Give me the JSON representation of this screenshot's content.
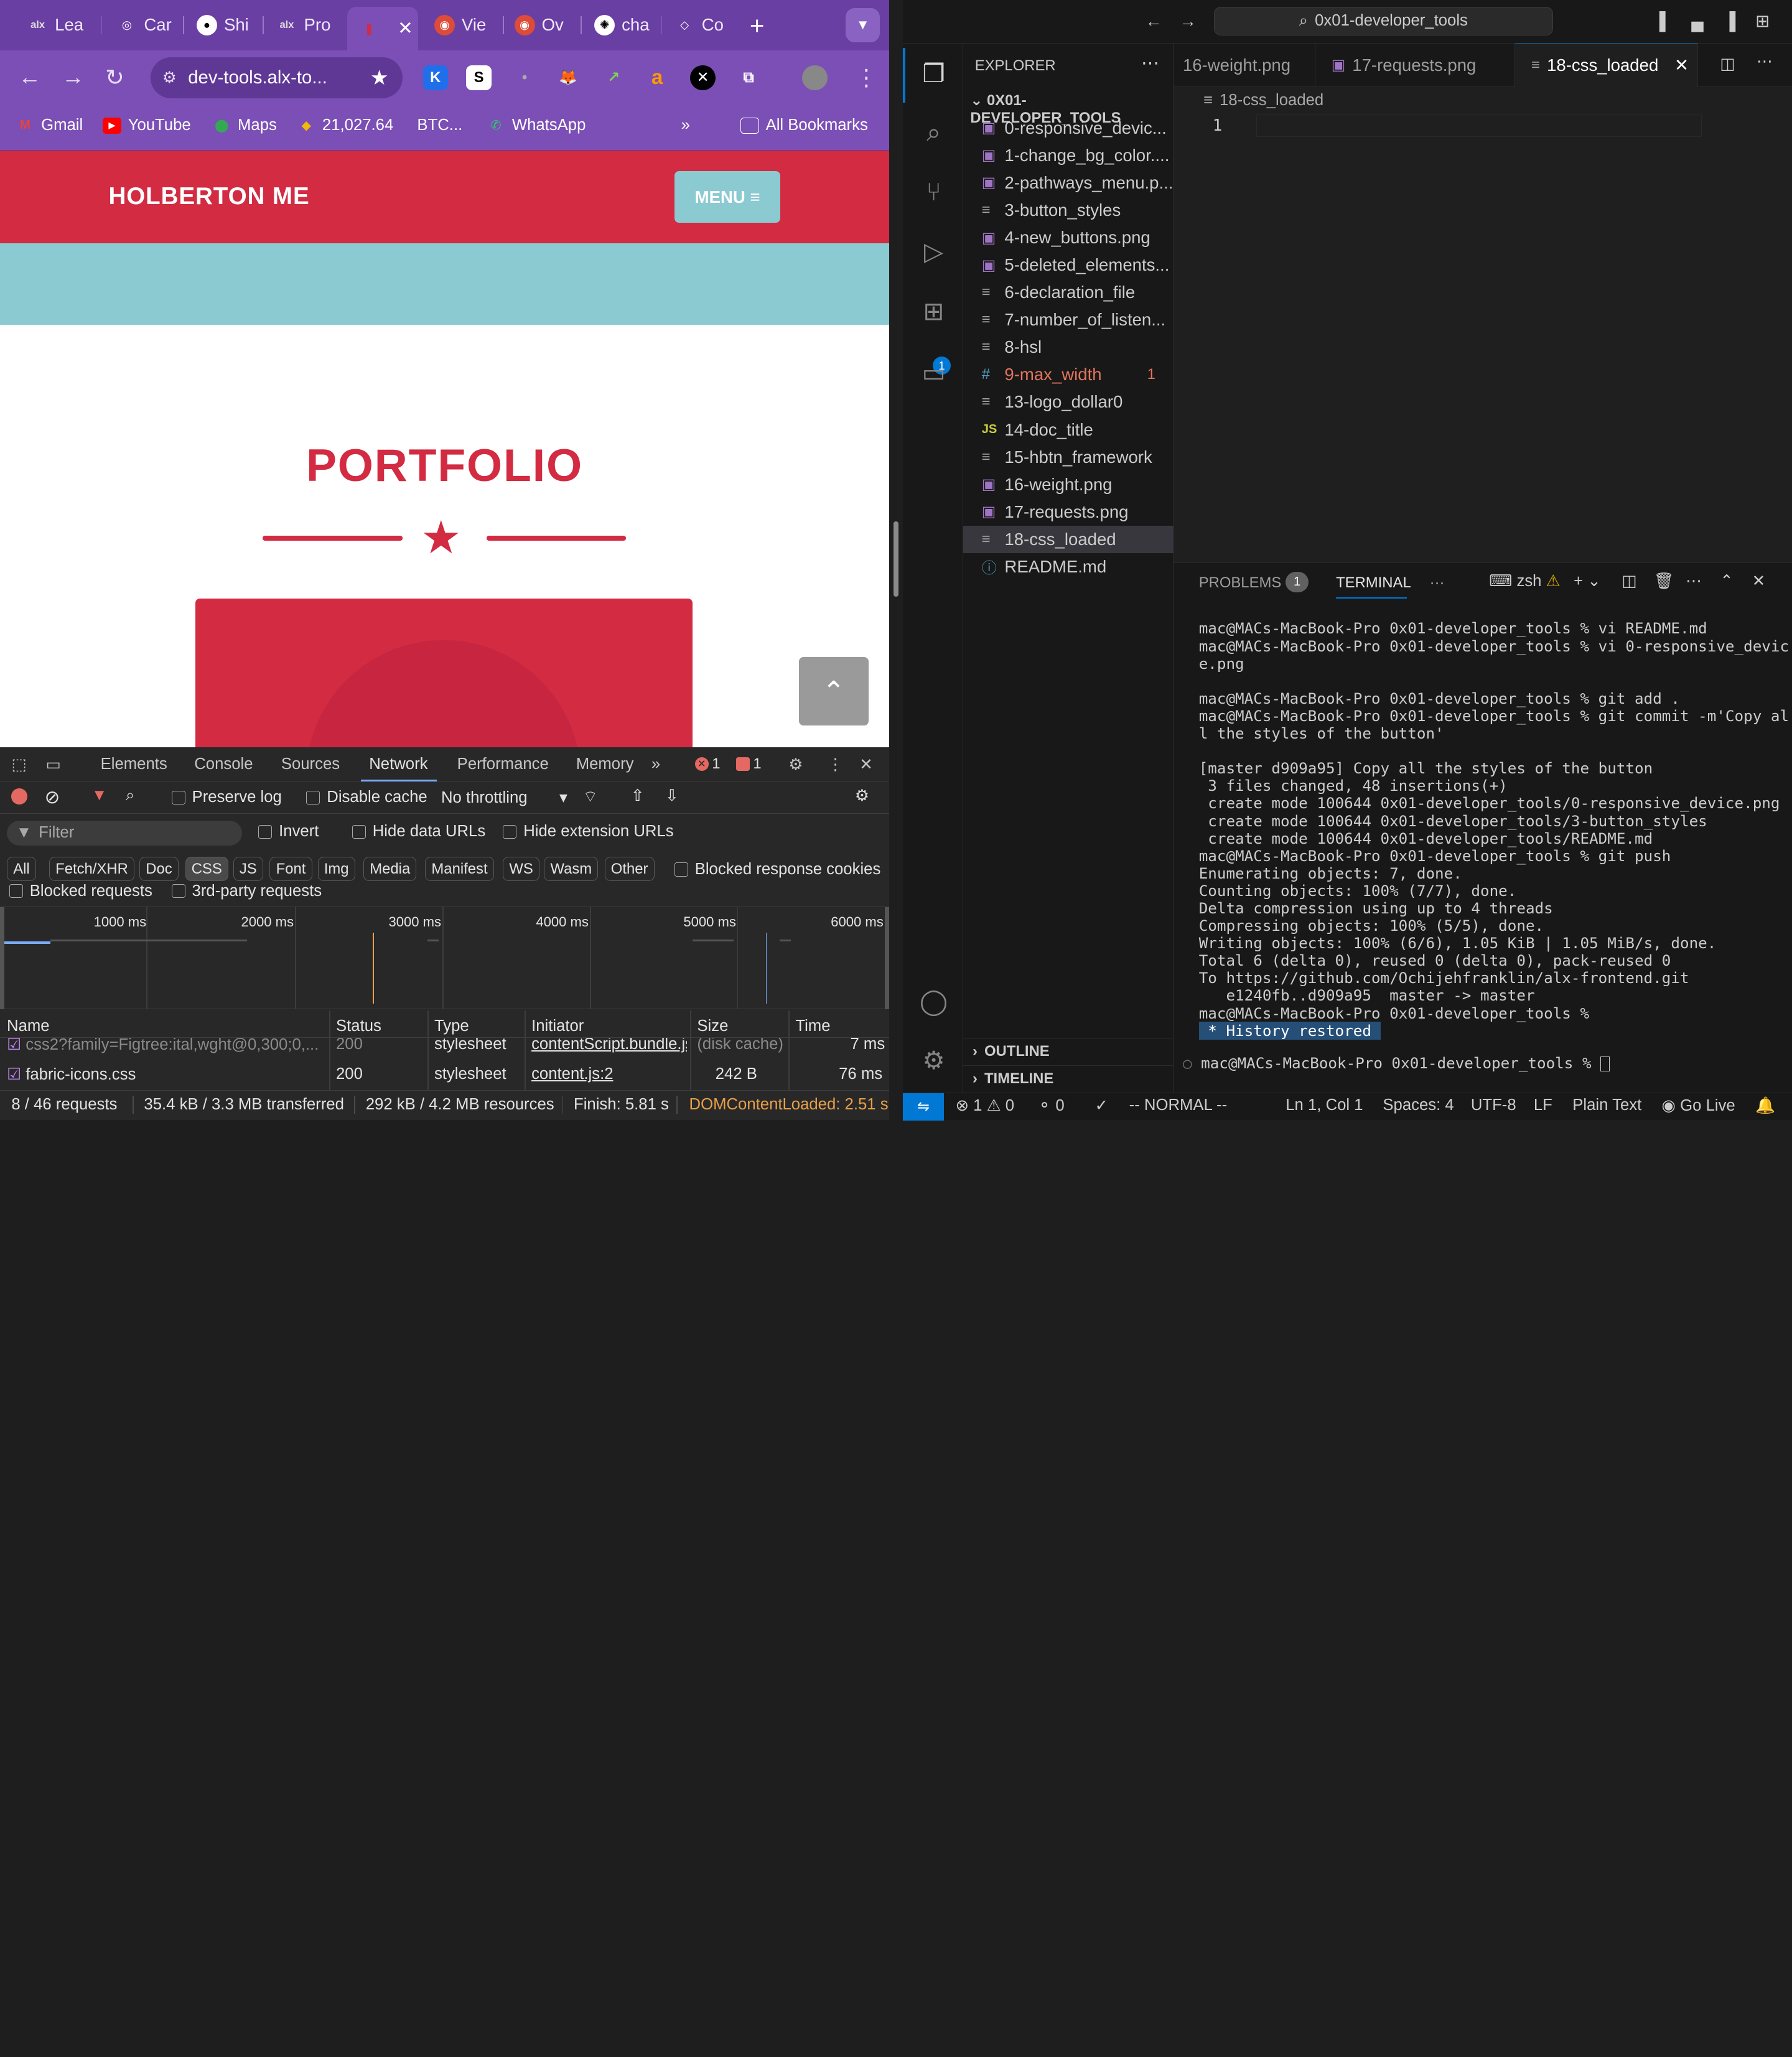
{
  "browser": {
    "tabs": [
      {
        "label": "Lea",
        "icon": "alx-icon"
      },
      {
        "label": "Car",
        "icon": "web-icon"
      },
      {
        "label": "Shi",
        "icon": "github-icon"
      },
      {
        "label": "Pro",
        "icon": "alx-icon"
      },
      {
        "label": "",
        "icon": "holberton-icon"
      },
      {
        "label": "Vie",
        "icon": "chrome-icon"
      },
      {
        "label": "Ov",
        "icon": "chrome-icon"
      },
      {
        "label": "cha",
        "icon": "openai-icon"
      },
      {
        "label": "Co",
        "icon": "web-icon"
      }
    ],
    "url": "dev-tools.alx-to...",
    "extensions": [
      "K",
      "S",
      "•",
      "🦊",
      "↗",
      "a",
      "✕",
      "⧉"
    ],
    "bookmarks": [
      {
        "label": "Gmail",
        "icon": "gmail-icon"
      },
      {
        "label": "YouTube",
        "icon": "youtube-icon"
      },
      {
        "label": "Maps",
        "icon": "maps-icon"
      },
      {
        "label": "21,027.64",
        "icon": "binance-icon"
      },
      {
        "label": "BTC...",
        "icon": ""
      },
      {
        "label": "WhatsApp",
        "icon": "whatsapp-icon"
      }
    ],
    "all_bookmarks": "All Bookmarks"
  },
  "page": {
    "logo": "HOLBERTON ME",
    "menu_label": "MENU ≡",
    "section_title": "PORTFOLIO",
    "scroll_top": "⌃",
    "colors": {
      "brand": "#d22b42",
      "teal": "#8ccad1"
    }
  },
  "devtools": {
    "tabs": [
      "Elements",
      "Console",
      "Sources",
      "Network",
      "Performance",
      "Memory"
    ],
    "active_tab": "Network",
    "errors": "1",
    "issues": "1",
    "preserve_log": "Preserve log",
    "disable_cache": "Disable cache",
    "throttling": "No throttling",
    "filter_placeholder": "Filter",
    "invert": "Invert",
    "hide_data_urls": "Hide data URLs",
    "hide_ext_urls": "Hide extension URLs",
    "type_filters": [
      "All",
      "Fetch/XHR",
      "Doc",
      "CSS",
      "JS",
      "Font",
      "Img",
      "Media",
      "Manifest",
      "WS",
      "Wasm",
      "Other"
    ],
    "active_filter": "CSS",
    "blocked_response_cookies": "Blocked response cookies",
    "blocked_requests": "Blocked requests",
    "third_party": "3rd-party requests",
    "timeline_labels": [
      "1000 ms",
      "2000 ms",
      "3000 ms",
      "4000 ms",
      "5000 ms",
      "6000 ms"
    ],
    "columns": [
      "Name",
      "Status",
      "Type",
      "Initiator",
      "Size",
      "Time"
    ],
    "rows": [
      {
        "name": "css2?family=Figtree:ital,wght@0,300;0,...",
        "status": "200",
        "type": "stylesheet",
        "initiator": "contentScript.bundle.js",
        "size": "(disk cache)",
        "time": "7 ms"
      },
      {
        "name": "fabric-icons.css",
        "status": "200",
        "type": "stylesheet",
        "initiator": "content.js:2",
        "size": "242 B",
        "time": "76 ms"
      }
    ],
    "summary": {
      "requests": "8 / 46 requests",
      "transferred": "35.4 kB / 3.3 MB transferred",
      "resources": "292 kB / 4.2 MB resources",
      "finish": "Finish: 5.81 s",
      "dcl": "DOMContentLoaded: 2.51 s"
    }
  },
  "vscode": {
    "command_center": "0x01-developer_tools",
    "explorer_title": "EXPLORER",
    "folder": "0X01-DEVELOPER_TOOLS",
    "files": [
      {
        "name": "0-responsive_devic...",
        "kind": "img"
      },
      {
        "name": "1-change_bg_color....",
        "kind": "img"
      },
      {
        "name": "2-pathways_menu.p...",
        "kind": "img"
      },
      {
        "name": "3-button_styles",
        "kind": "txt"
      },
      {
        "name": "4-new_buttons.png",
        "kind": "img"
      },
      {
        "name": "5-deleted_elements...",
        "kind": "img"
      },
      {
        "name": "6-declaration_file",
        "kind": "txt"
      },
      {
        "name": "7-number_of_listen...",
        "kind": "txt"
      },
      {
        "name": "8-hsl",
        "kind": "txt"
      },
      {
        "name": "9-max_width",
        "kind": "css",
        "problems": "1"
      },
      {
        "name": "13-logo_dollar0",
        "kind": "txt"
      },
      {
        "name": "14-doc_title",
        "kind": "js"
      },
      {
        "name": "15-hbtn_framework",
        "kind": "txt"
      },
      {
        "name": "16-weight.png",
        "kind": "img"
      },
      {
        "name": "17-requests.png",
        "kind": "img"
      },
      {
        "name": "18-css_loaded",
        "kind": "txt",
        "selected": true
      },
      {
        "name": "README.md",
        "kind": "info"
      }
    ],
    "outline": "OUTLINE",
    "timeline": "TIMELINE",
    "editor_tabs": [
      "16-weight.png",
      "17-requests.png",
      "18-css_loaded"
    ],
    "breadcrumb": "18-css_loaded",
    "line_number": "1",
    "panel": {
      "problems": "PROBLEMS",
      "problems_count": "1",
      "terminal": "TERMINAL",
      "shell": "zsh"
    },
    "terminal_lines": [
      "mac@MACs-MacBook-Pro 0x01-developer_tools % vi README.md",
      "mac@MACs-MacBook-Pro 0x01-developer_tools % vi 0-responsive_devic",
      "e.png",
      "",
      "mac@MACs-MacBook-Pro 0x01-developer_tools % git add .",
      "mac@MACs-MacBook-Pro 0x01-developer_tools % git commit -m'Copy al",
      "l the styles of the button'",
      "",
      "[master d909a95] Copy all the styles of the button",
      " 3 files changed, 48 insertions(+)",
      " create mode 100644 0x01-developer_tools/0-responsive_device.png",
      " create mode 100644 0x01-developer_tools/3-button_styles",
      " create mode 100644 0x01-developer_tools/README.md",
      "mac@MACs-MacBook-Pro 0x01-developer_tools % git push",
      "Enumerating objects: 7, done.",
      "Counting objects: 100% (7/7), done.",
      "Delta compression using up to 4 threads",
      "Compressing objects: 100% (5/5), done.",
      "Writing objects: 100% (6/6), 1.05 KiB | 1.05 MiB/s, done.",
      "Total 6 (delta 0), reused 0 (delta 0), pack-reused 0",
      "To https://github.com/Ochijehfranklin/alx-frontend.git",
      "   e1240fb..d909a95  master -> master",
      "mac@MACs-MacBook-Pro 0x01-developer_tools %"
    ],
    "history_restored": " * History restored ",
    "prompt": "mac@MACs-MacBook-Pro 0x01-developer_tools % ",
    "status": {
      "errors": "⊗ 1 ⚠ 0",
      "ports": "⚬ 0",
      "mode": "-- NORMAL --",
      "position": "Ln 1, Col 1",
      "spaces": "Spaces: 4",
      "encoding": "UTF-8",
      "eol": "LF",
      "language": "Plain Text",
      "golive": "Go Live"
    }
  }
}
